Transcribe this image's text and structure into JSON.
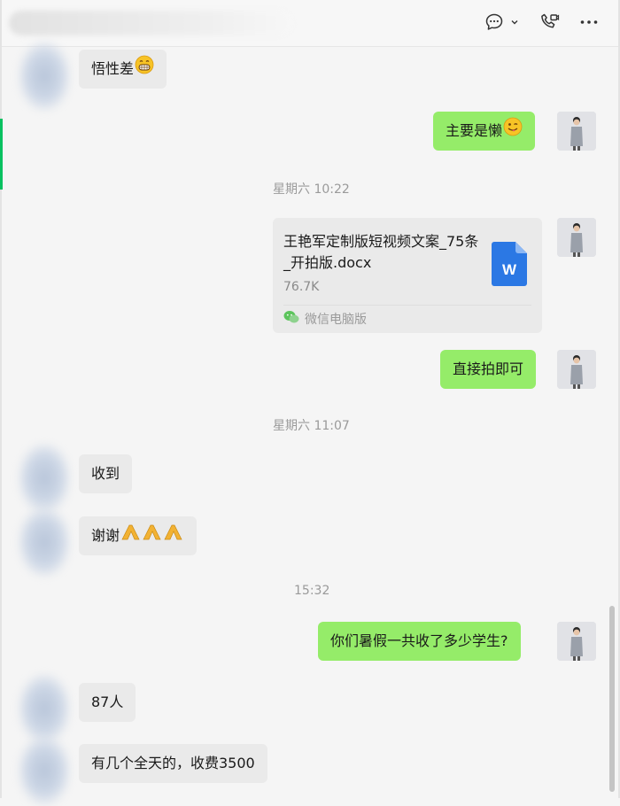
{
  "header": {
    "chat_icon": "chat-bubble-dots-icon",
    "dropdown_icon": "chevron-down-icon",
    "call_icon": "phone-video-icon",
    "more_icon": "more-dots-icon"
  },
  "messages": [
    {
      "side": "in",
      "text": "悟性差",
      "emoji": "grinning-face-icon"
    },
    {
      "side": "out",
      "text": "主要是懒",
      "emoji": "winking-tongue-face-icon"
    },
    {
      "type": "timestamp",
      "text": "星期六 10:22"
    },
    {
      "side": "out",
      "type": "file",
      "file_name": "王艳军定制版短视频文案_75条_开拍版.docx",
      "file_size": "76.7K",
      "source": "微信电脑版",
      "file_icon": "word-document-icon"
    },
    {
      "side": "out",
      "text": "直接拍即可"
    },
    {
      "type": "timestamp",
      "text": "星期六 11:07"
    },
    {
      "side": "in",
      "text": "收到"
    },
    {
      "side": "in",
      "text": "谢谢",
      "emoji": "folded-hands-icon"
    },
    {
      "type": "timestamp",
      "text": "15:32"
    },
    {
      "side": "out",
      "text": "你们暑假一共收了多少学生?"
    },
    {
      "side": "in",
      "text": "87人"
    },
    {
      "side": "in",
      "text": "有几个全天的，收费3500"
    }
  ],
  "colors": {
    "outgoing_bubble": "#95ec69",
    "incoming_bubble": "#eaeaea",
    "accent": "#07c160",
    "timestamp": "#9a9a9a"
  }
}
